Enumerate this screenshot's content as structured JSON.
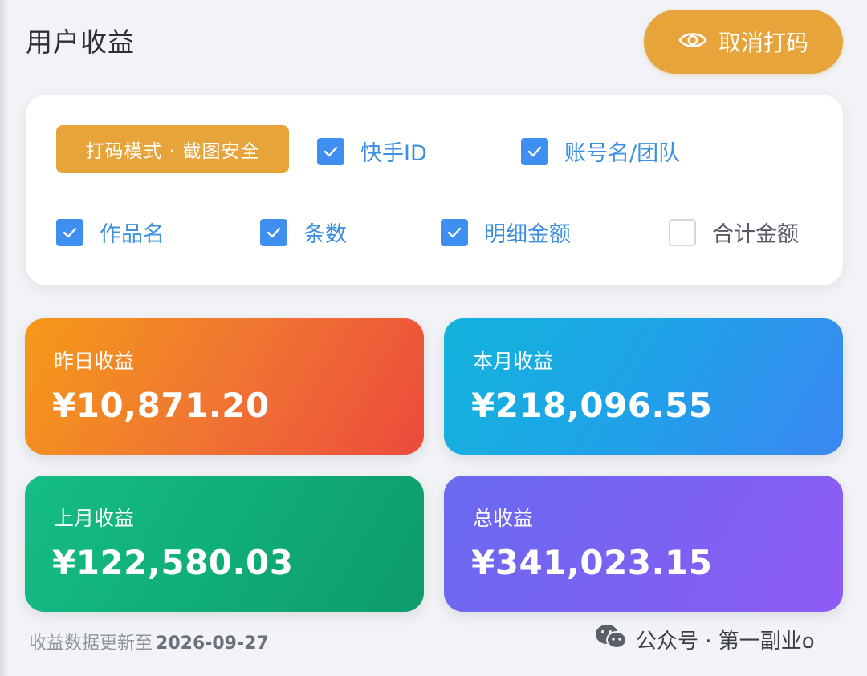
{
  "header": {
    "title": "用户收益",
    "toggle_label": "取消打码"
  },
  "panel": {
    "mode_badge": "打码模式 · 截图安全",
    "options": [
      {
        "label": "快手ID",
        "checked": true
      },
      {
        "label": "账号名/团队",
        "checked": true
      },
      {
        "label": "作品名",
        "checked": true
      },
      {
        "label": "条数",
        "checked": true
      },
      {
        "label": "明细金额",
        "checked": true
      },
      {
        "label": "合计金额",
        "checked": false
      }
    ]
  },
  "cards": {
    "yesterday": {
      "label": "昨日收益",
      "amount": "¥10,871.20"
    },
    "this_month": {
      "label": "本月收益",
      "amount": "¥218,096.55"
    },
    "last_month": {
      "label": "上月收益",
      "amount": "¥122,580.03"
    },
    "total": {
      "label": "总收益",
      "amount": "¥341,023.15"
    }
  },
  "footer": {
    "note": "收益数据更新至",
    "date": "2026-09-27"
  },
  "watermark": {
    "text": "公众号 · 第一副业o"
  },
  "colors": {
    "accent": "#e6a43a",
    "checkbox": "#3f8ff0",
    "check_label": "#3d8fe0"
  },
  "icons": {
    "toggle": "eye-icon",
    "check": "checkmark-icon",
    "watermark": "wechat-icon"
  }
}
